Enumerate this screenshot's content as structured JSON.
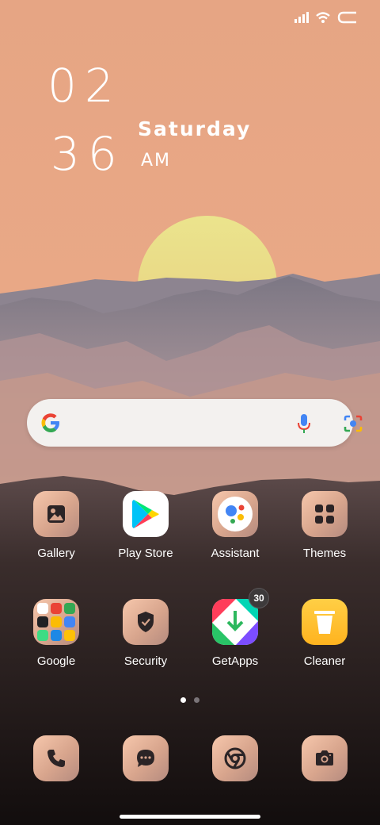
{
  "status_bar": {
    "icons": [
      "signal-icon",
      "wifi-icon",
      "battery-icon"
    ]
  },
  "clock": {
    "hour": "02",
    "minute": "36",
    "day": "Saturday",
    "ampm": "AM"
  },
  "search": {
    "icons": [
      "google-logo-icon",
      "microphone-icon",
      "lens-icon"
    ]
  },
  "apps": [
    {
      "label": "Gallery",
      "icon": "gallery-icon"
    },
    {
      "label": "Play Store",
      "icon": "play-store-icon"
    },
    {
      "label": "Assistant",
      "icon": "assistant-icon"
    },
    {
      "label": "Themes",
      "icon": "themes-icon"
    },
    {
      "label": "Google",
      "icon": "google-folder-icon"
    },
    {
      "label": "Security",
      "icon": "security-shield-icon"
    },
    {
      "label": "GetApps",
      "icon": "getapps-icon",
      "badge": "30"
    },
    {
      "label": "Cleaner",
      "icon": "cleaner-icon"
    }
  ],
  "page_indicator": {
    "pages": 2,
    "current": 1
  },
  "dock": [
    {
      "icon": "phone-icon"
    },
    {
      "icon": "messages-icon"
    },
    {
      "icon": "chrome-icon"
    },
    {
      "icon": "camera-icon"
    }
  ],
  "colors": {
    "sky": "#e9a985",
    "sun": "#e8df8a",
    "mountains": "#7d7885",
    "ground": "#1c1514"
  }
}
